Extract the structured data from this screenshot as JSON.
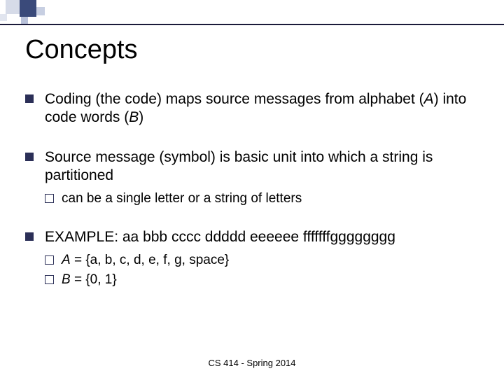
{
  "title": "Concepts",
  "bullets": {
    "b1": "Coding (the code) maps source messages from alphabet (",
    "b1_A": "A",
    "b1_mid": ") into code words (",
    "b1_B": "B",
    "b1_end": ")",
    "b2": "Source message (symbol) is basic unit into which a string is partitioned",
    "b2_sub1": "can be a single letter or a string of letters",
    "b3": "EXAMPLE: aa bbb cccc ddddd eeeeee fffffffgggggggg",
    "b3_sub1_A": "A",
    "b3_sub1_rest": " = {a, b, c, d, e, f, g, space}",
    "b3_sub2_B": "B",
    "b3_sub2_rest": " = {0, 1}"
  },
  "footer": "CS 414 - Spring 2014"
}
